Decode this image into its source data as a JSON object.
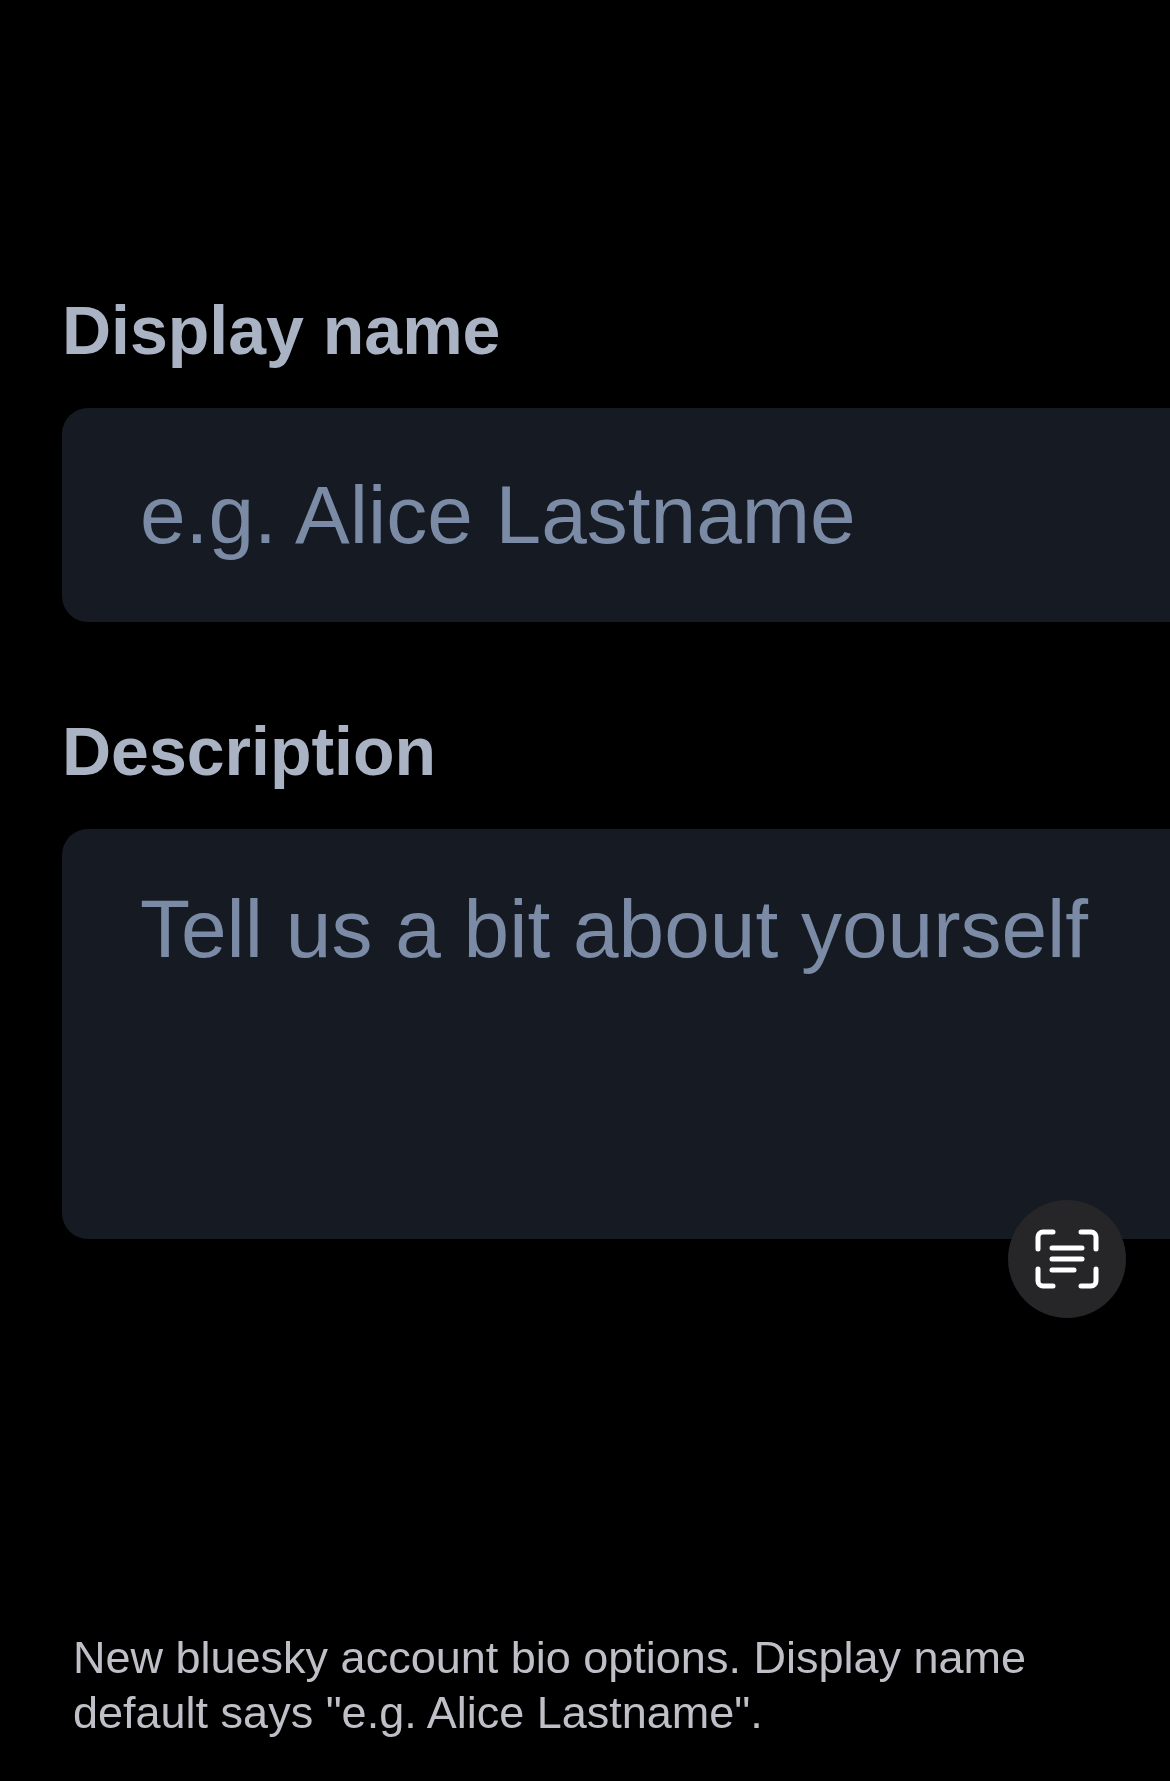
{
  "form": {
    "fields": [
      {
        "kind": "text",
        "label": "Display name",
        "placeholder": "e.g. Alice Lastname"
      },
      {
        "kind": "multiline",
        "label": "Description",
        "placeholder": "Tell us a bit about yourself"
      }
    ]
  },
  "caption": "New bluesky account bio options. Display name default says \"e.g. Alice Lastname\"."
}
